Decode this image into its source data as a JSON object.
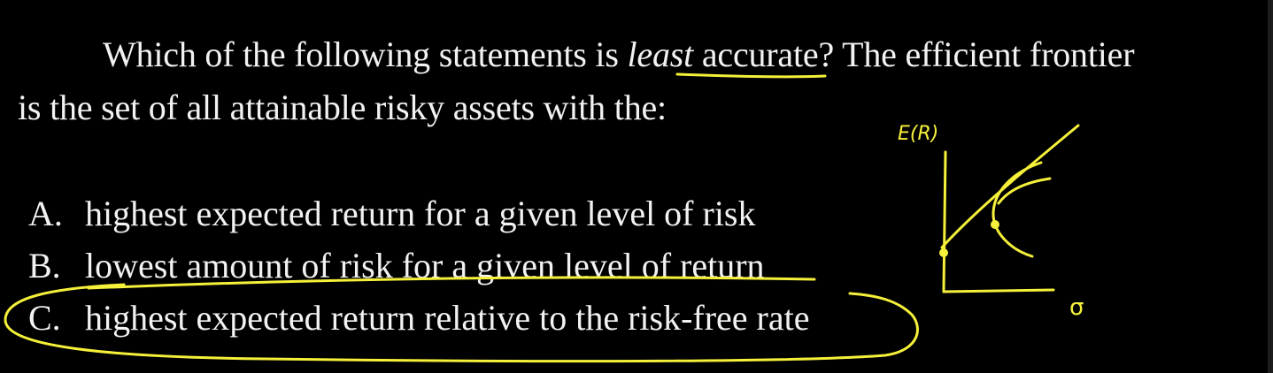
{
  "question": {
    "part1": "Which of the following statements is ",
    "emphasis": "least",
    "part2": " accurate? The efficient frontier",
    "line2": "is the set of all attainable risky assets with the:"
  },
  "options": [
    {
      "letter": "A.",
      "text": "highest expected return for a given level of risk"
    },
    {
      "letter": "B.",
      "text": "lowest amount of risk for a given level of return"
    },
    {
      "letter": "C.",
      "text": "highest expected return relative to the risk-free rate"
    }
  ],
  "annotations": {
    "y_axis_label": "E(R)",
    "x_axis_label": "σ",
    "ink_color": "#f5f03a"
  }
}
